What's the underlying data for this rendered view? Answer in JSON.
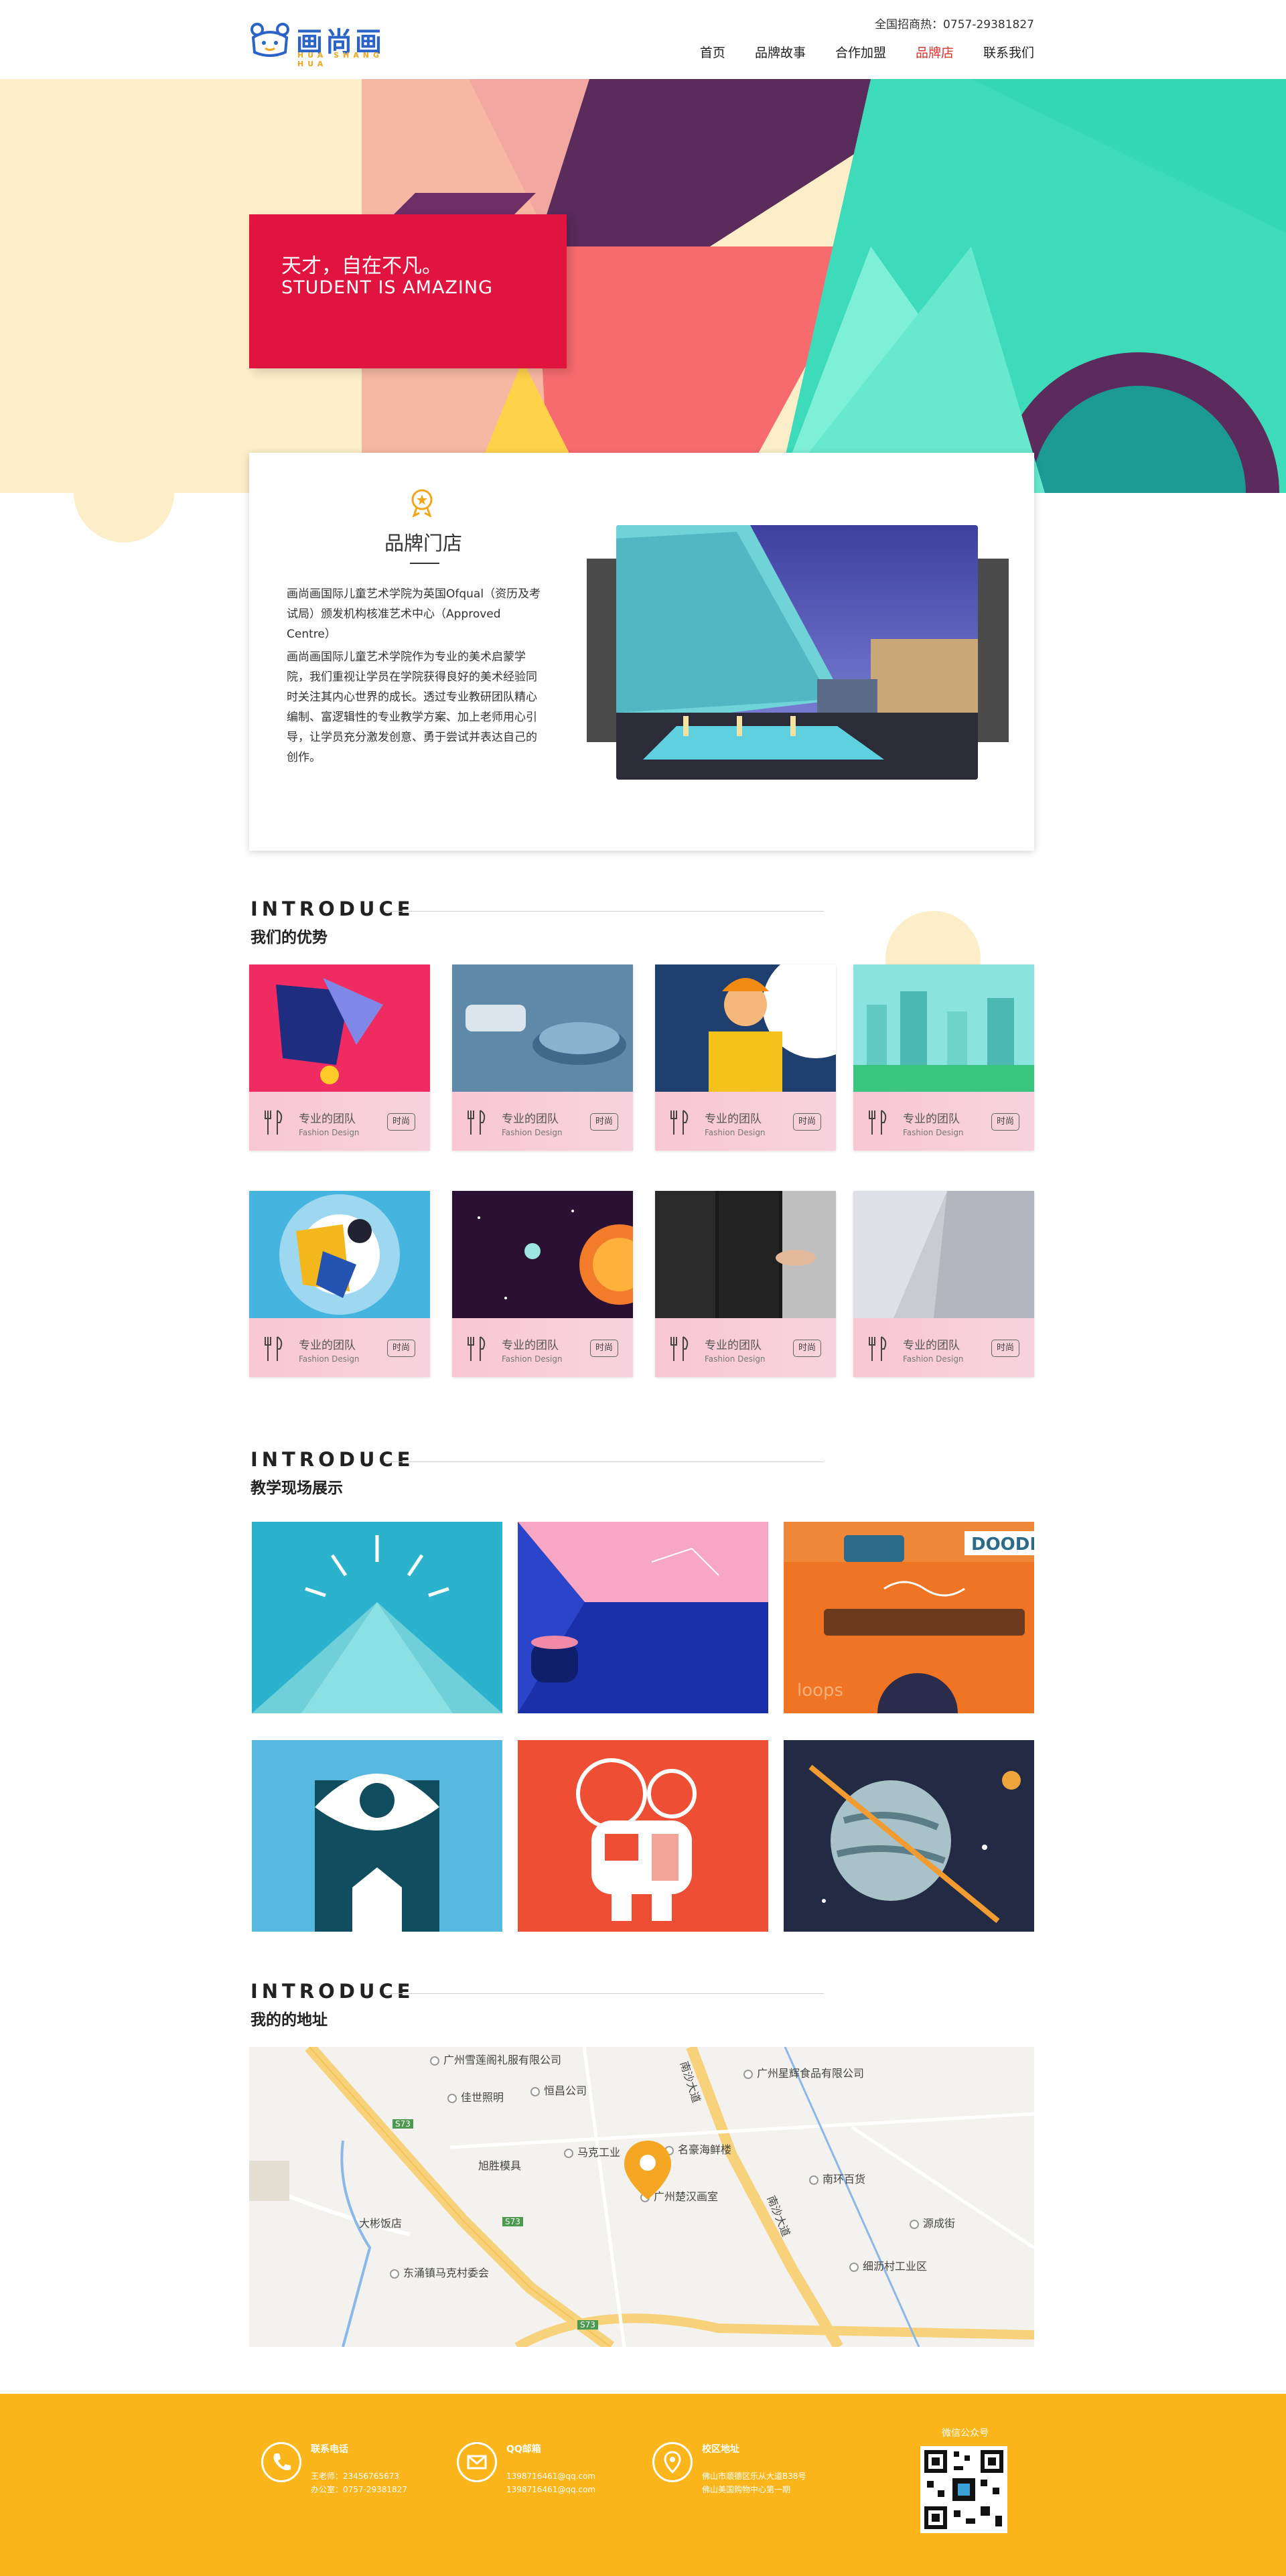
{
  "header": {
    "logo_text": "画尚画",
    "logo_sub": "HUA SHANG HUA",
    "hotline": "全国招商热：0757-29381827",
    "nav": [
      {
        "label": "首页",
        "active": false
      },
      {
        "label": "品牌故事",
        "active": false
      },
      {
        "label": "合作加盟",
        "active": false
      },
      {
        "label": "品牌店",
        "active": true
      },
      {
        "label": "联系我们",
        "active": false
      }
    ]
  },
  "hero": {
    "line1": "天才，自在不凡。",
    "line2": "STUDENT IS AMAZING"
  },
  "brand": {
    "title": "品牌门店",
    "para1": "画尚画国际儿童艺术学院为英国Ofqual（资历及考试局）颁发机构核准艺术中心（Approved Centre）",
    "para2": "画尚画国际儿童艺术学院作为专业的美术启蒙学院，我们重视让学员在学院获得良好的美术经验同时关注其内心世界的成长。透过专业教研团队精心编制、富逻辑性的专业教学方案、加上老师用心引导，让学员充分激发创意、勇于尝试并表达自己的创作。"
  },
  "advantages": {
    "en": "INTRODUCE",
    "cn": "我们的优势",
    "items": [
      {
        "title": "专业的团队",
        "sub": "Fashion Design",
        "btn": "时尚"
      },
      {
        "title": "专业的团队",
        "sub": "Fashion Design",
        "btn": "时尚"
      },
      {
        "title": "专业的团队",
        "sub": "Fashion Design",
        "btn": "时尚"
      },
      {
        "title": "专业的团队",
        "sub": "Fashion Design",
        "btn": "时尚"
      },
      {
        "title": "专业的团队",
        "sub": "Fashion Design",
        "btn": "时尚"
      },
      {
        "title": "专业的团队",
        "sub": "Fashion Design",
        "btn": "时尚"
      },
      {
        "title": "专业的团队",
        "sub": "Fashion Design",
        "btn": "时尚"
      },
      {
        "title": "专业的团队",
        "sub": "Fashion Design",
        "btn": "时尚"
      }
    ]
  },
  "teaching": {
    "en": "INTRODUCE",
    "cn": "教学现场展示",
    "doodle": "DOODL",
    "loops": "loops"
  },
  "address": {
    "en": "INTRODUCE",
    "cn": "我的的地址",
    "map_labels": {
      "p1": "广州雪莲阁礼服有限公司",
      "p2": "恒昌公司",
      "p3": "佳世照明",
      "p4": "广州星辉食品有限公司",
      "p5": "马克工业",
      "p6": "名豪海鲜楼",
      "p7": "旭胜模具",
      "p8": "广州楚汉画室",
      "p9": "南环百货",
      "p10": "大彬饭店",
      "p11": "源成街",
      "p12": "东涌镇马克村委会",
      "p13": "细沥村工业区",
      "road": "南沙大道",
      "road2": "南沙大道",
      "s1": "S73",
      "s2": "S73",
      "s3": "S73"
    }
  },
  "footer": {
    "phone_title": "联系电话",
    "phone_l1": "王老师：23456765673",
    "phone_l2": "办公室：0757-29381827",
    "mail_title": "QQ邮箱",
    "mail_l1": "1398716461@qq.com",
    "mail_l2": "1398716461@qq.com",
    "addr_title": "校区地址",
    "addr_l1": "佛山市顺德区乐从大道B38号",
    "addr_l2": "佛山美国购物中心第一期",
    "qr_title": "微信公众号"
  },
  "colors": {
    "accent_red": "#e0143f",
    "nav_active": "#e0312b",
    "footer": "#fcb61b",
    "logo_blue": "#2b63c6"
  }
}
